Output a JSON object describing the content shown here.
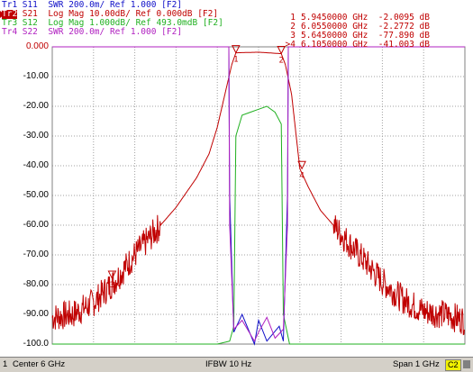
{
  "traces": [
    {
      "id": "Tr1",
      "text": "S11  SWR 200.0m/ Ref 1.000 [F2]"
    },
    {
      "id": "Tr2",
      "text": "S21  Log Mag 10.00dB/ Ref 0.000dB [F2]"
    },
    {
      "id": "Tr3",
      "text": "S12  Log Mag 1.000dB/ Ref 493.0mdB [F2]"
    },
    {
      "id": "Tr4",
      "text": "S22  SWR 200.0m/ Ref 1.000 [F2]"
    }
  ],
  "markers_table": [
    {
      "num": "1",
      "text": "5.9450000 GHz  -2.0095 dB"
    },
    {
      "num": "2",
      "text": "6.0550000 GHz  -2.2772 dB"
    },
    {
      "num": "3",
      "text": "5.6450000 GHz  -77.890 dB"
    },
    {
      "num": ">4",
      "text": "6.1050000 GHz  -41.003 dB"
    }
  ],
  "y_labels": [
    "0.000",
    "-10.00",
    "-20.00",
    "-30.00",
    "-40.00",
    "-50.00",
    "-60.00",
    "-70.00",
    "-80.00",
    "-90.00",
    "-100.0"
  ],
  "status": {
    "channel": "1",
    "center": "Center 6 GHz",
    "ifbw": "IFBW 10 Hz",
    "span": "Span 1 GHz",
    "c2": "C2"
  },
  "colors": {
    "s11": "#1010c8",
    "s21": "#c00000",
    "s12": "#20b020",
    "s22": "#b020c0",
    "grid": "#a0a0a0"
  },
  "chart_data": {
    "type": "line",
    "x_start_ghz": 5.5,
    "x_stop_ghz": 6.5,
    "ylim": [
      -100,
      0
    ],
    "y_per_div_db": 10,
    "grid": true,
    "series": [
      {
        "name": "S21",
        "x": [
          5.5,
          5.55,
          5.6,
          5.65,
          5.7,
          5.75,
          5.8,
          5.85,
          5.88,
          5.9,
          5.92,
          5.935,
          5.945,
          6.0,
          6.055,
          6.065,
          6.08,
          6.1,
          6.12,
          6.15,
          6.2,
          6.25,
          6.3,
          6.35,
          6.4,
          6.45,
          6.5
        ],
        "y": [
          -91,
          -90,
          -86,
          -79,
          -70,
          -62,
          -54,
          -44,
          -36,
          -27,
          -15,
          -6,
          -2.0,
          -1.8,
          -2.3,
          -6,
          -16,
          -41,
          -47,
          -55,
          -63,
          -71,
          -79,
          -85,
          -89,
          -90,
          -92
        ]
      },
      {
        "name": "S12",
        "x": [
          5.5,
          5.9,
          5.93,
          5.94,
          5.945,
          5.96,
          5.98,
          6.0,
          6.02,
          6.04,
          6.055,
          6.06,
          6.075,
          6.5
        ],
        "y": [
          -100,
          -100,
          -99,
          -94,
          -30,
          -23,
          -22,
          -21,
          -20,
          -22,
          -26,
          -90,
          -100,
          -100
        ]
      },
      {
        "name": "S11",
        "x": [
          5.5,
          5.928,
          5.93,
          5.94,
          5.96,
          5.99,
          6.0,
          6.02,
          6.05,
          6.06,
          6.07,
          6.072,
          6.5
        ],
        "y": [
          0,
          0,
          -50,
          -96,
          -90,
          -100,
          -92,
          -99,
          -94,
          -99,
          -50,
          0,
          0
        ]
      },
      {
        "name": "S22",
        "x": [
          5.5,
          5.928,
          5.93,
          5.94,
          5.96,
          5.99,
          6.0,
          6.02,
          6.04,
          6.06,
          6.07,
          6.072,
          6.5
        ],
        "y": [
          0,
          0,
          -60,
          -95,
          -92,
          -99,
          -96,
          -91,
          -98,
          -95,
          -60,
          0,
          0
        ]
      }
    ],
    "markers": [
      {
        "label": "1",
        "x": 5.945,
        "y": -2.0095
      },
      {
        "label": "2",
        "x": 6.055,
        "y": -2.2772
      },
      {
        "label": "3",
        "x": 5.645,
        "y": -77.89
      },
      {
        "label": "4",
        "x": 6.105,
        "y": -41.003
      }
    ]
  }
}
